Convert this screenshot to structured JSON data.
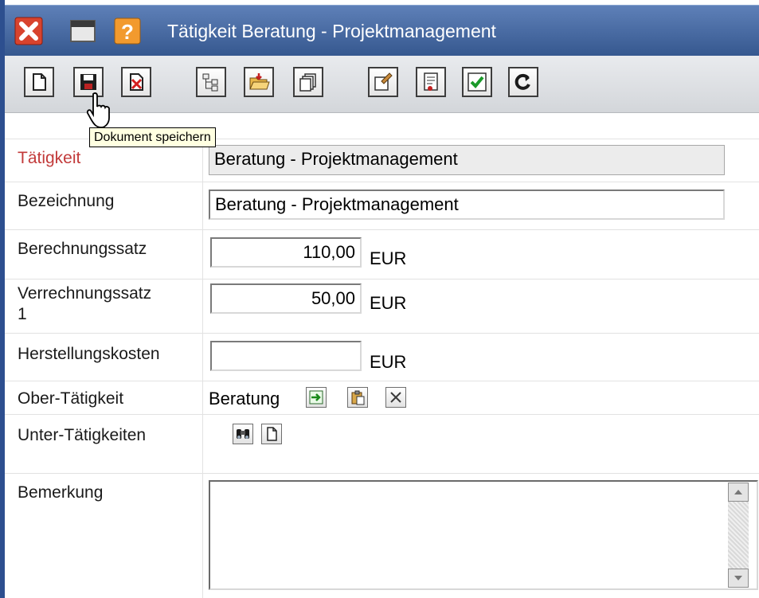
{
  "window": {
    "title": "Tätigkeit Beratung - Projektmanagement"
  },
  "titlebar": {
    "icons": [
      "close-icon",
      "minimize-icon",
      "help-icon"
    ]
  },
  "toolbar": {
    "buttons": [
      "new-document-icon",
      "save-icon",
      "delete-icon",
      "tree-icon",
      "open-folder-icon",
      "copy-icon",
      "properties-icon",
      "report-icon",
      "check-icon",
      "refresh-icon"
    ],
    "tooltip": "Dokument speichern"
  },
  "form": {
    "taetigkeit": {
      "label": "Tätigkeit",
      "value": "Beratung - Projektmanagement"
    },
    "bezeichnung": {
      "label": "Bezeichnung",
      "value": "Beratung - Projektmanagement"
    },
    "berechnungssatz": {
      "label": "Berechnungssatz",
      "value": "110,00",
      "unit": "EUR"
    },
    "verrechnungssatz": {
      "label_line1": "Verrechnungssatz",
      "label_line2": "1",
      "value": "50,00",
      "unit": "EUR"
    },
    "herstellungskosten": {
      "label": "Herstellungskosten",
      "value": "",
      "unit": "EUR"
    },
    "ober_taetigkeit": {
      "label": "Ober-Tätigkeit",
      "value": "Beratung"
    },
    "unter_taetigkeiten": {
      "label": "Unter-Tätigkeiten"
    },
    "bemerkung": {
      "label": "Bemerkung",
      "value": ""
    }
  },
  "colors": {
    "titlebar": "#36588f",
    "required_label": "#c23a3a",
    "tooltip_bg": "#ffffe1"
  }
}
